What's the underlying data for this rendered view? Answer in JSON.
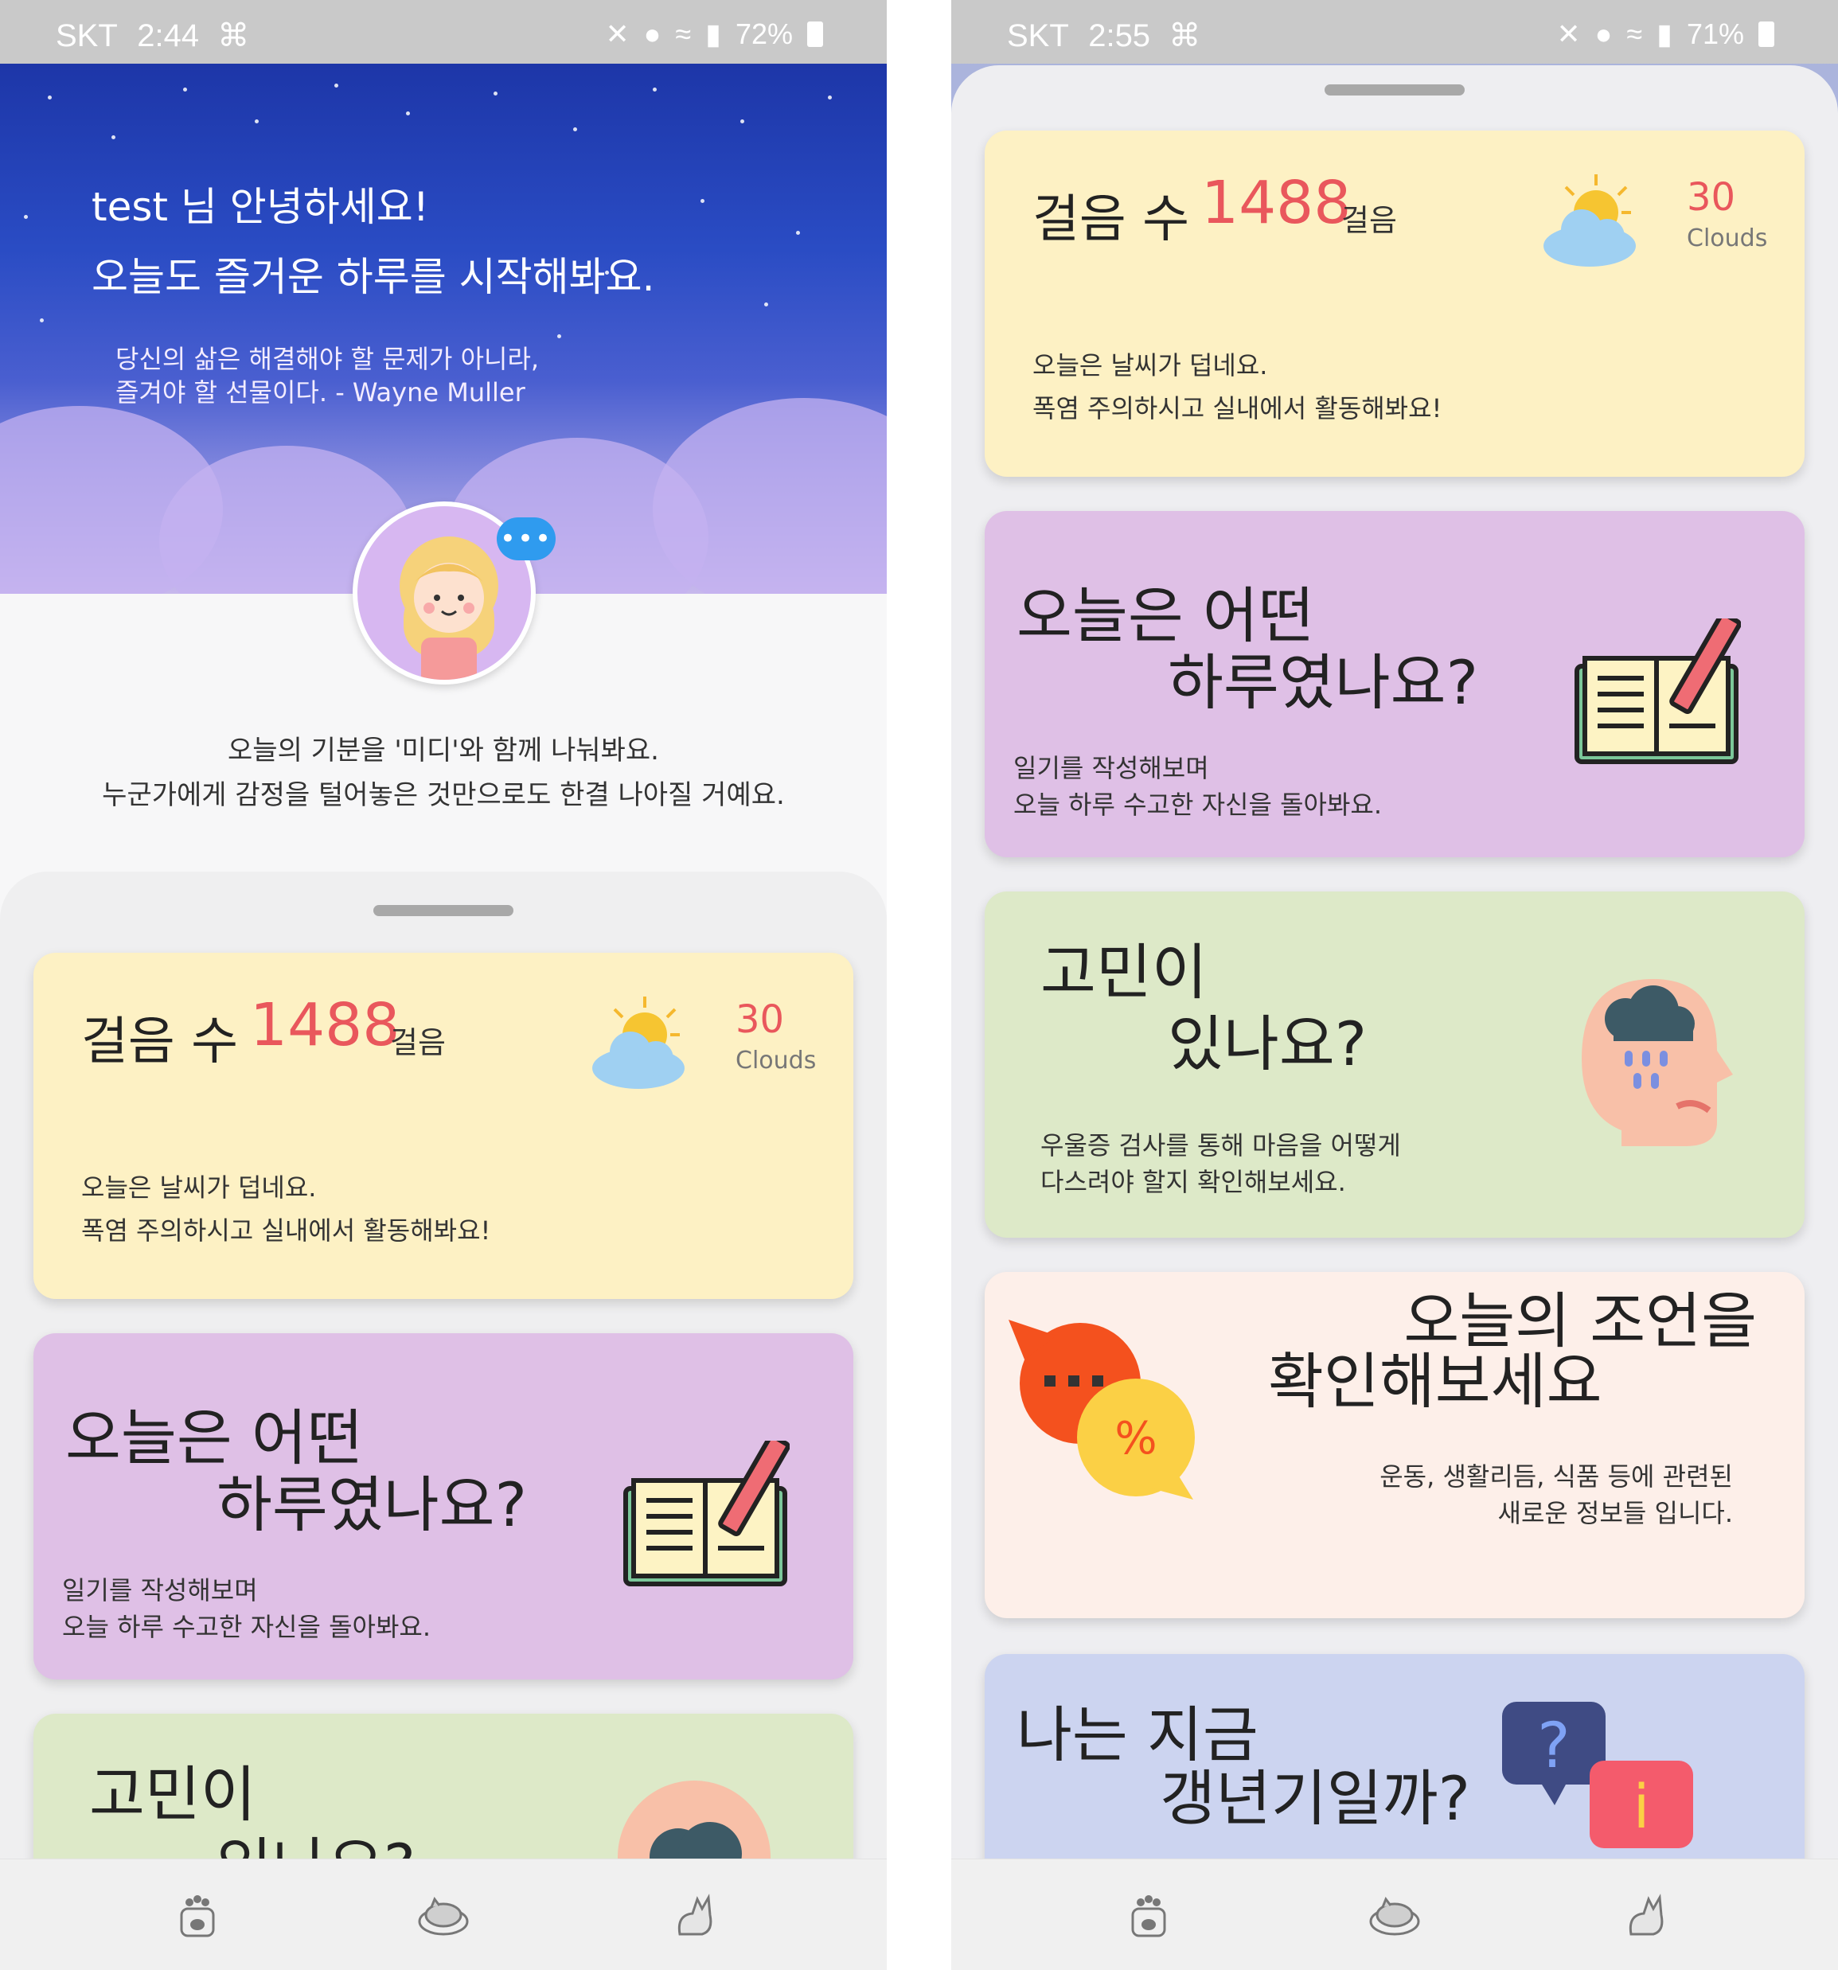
{
  "status": {
    "left": {
      "carrier": "SKT",
      "time": "2:44",
      "battery": "72%"
    },
    "right": {
      "carrier": "SKT",
      "time": "2:55",
      "battery": "71%"
    }
  },
  "hero": {
    "greeting_line1": "test 님 안녕하세요!",
    "greeting_line2": "오늘도 즐거운 하루를 시작해봐요.",
    "quote_line1": "당신의 삶은 해결해야 할 문제가 아니라,",
    "quote_line2": "즐겨야 할 선물이다. - Wayne Muller",
    "bubble": "•••"
  },
  "mood": {
    "line1": "오늘의 기분을 '미디'와 함께 나눠봐요.",
    "line2": "누군가에게 감정을 털어놓은 것만으로도 한결 나아질 거예요."
  },
  "steps_card": {
    "label": "걸음 수",
    "count": "1488",
    "unit": "걸음",
    "temperature": "30",
    "weather": "Clouds",
    "msg_line1": "오늘은 날씨가 덥네요.",
    "msg_line2": "폭염 주의하시고 실내에서 활동해봐요!"
  },
  "diary_card": {
    "title_line1": "오늘은 어떤",
    "title_line2": "하루였나요?",
    "sub_line1": "일기를 작성해보며",
    "sub_line2": "오늘 하루 수고한 자신을 돌아봐요."
  },
  "worry_card": {
    "title_line1": "고민이",
    "title_line2": "있나요?",
    "title_line2_partial": "있나요?",
    "sub_line1": "우울증 검사를 통해 마음을 어떻게",
    "sub_line2": "다스려야 할지 확인해보세요."
  },
  "advice_card": {
    "title_line1": "오늘의 조언을",
    "title_line2": "확인해보세요",
    "sub_line1": "운동, 생활리듬, 식품 등에 관련된",
    "sub_line2": "새로운 정보들 입니다."
  },
  "menopause_card": {
    "title_line1": "나는 지금",
    "title_line2": "갱년기일까?"
  },
  "colors": {
    "accent_red": "#e9575c",
    "card_yellow": "#fdf1c4",
    "card_purple": "#dfc0e6",
    "card_green": "#dde9c8",
    "card_pink": "#fdefe9",
    "card_blue": "#ccd4f0"
  },
  "nav_icons": [
    "paw-icon",
    "sleeping-cat-icon",
    "cat-icon"
  ]
}
